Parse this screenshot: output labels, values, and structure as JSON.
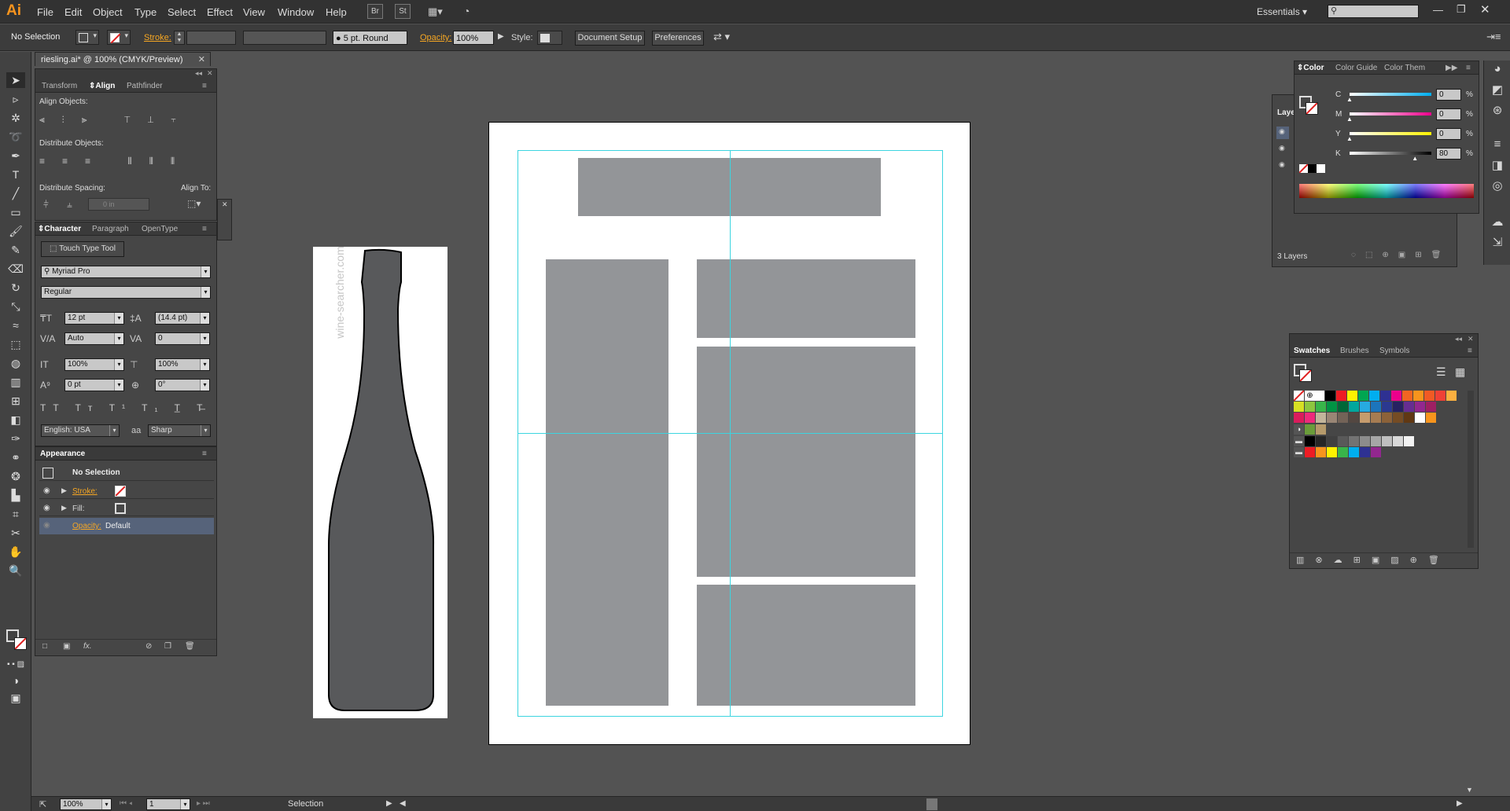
{
  "app": {
    "logo": "Ai",
    "workspace": "Essentials"
  },
  "menu": [
    "File",
    "Edit",
    "Object",
    "Type",
    "Select",
    "Effect",
    "View",
    "Window",
    "Help"
  ],
  "menu_buttons": {
    "br": "Br",
    "st": "St"
  },
  "control": {
    "selection": "No Selection",
    "stroke_label": "Stroke:",
    "brush": "5 pt. Round",
    "opacity_label": "Opacity:",
    "opacity": "100%",
    "style_label": "Style:",
    "doc_setup": "Document Setup",
    "preferences": "Preferences"
  },
  "document_tab": "riesling.ai* @ 100% (CMYK/Preview)",
  "align_panel": {
    "tabs": [
      "Transform",
      "Align",
      "Pathfinder"
    ],
    "align_objects": "Align Objects:",
    "distribute_objects": "Distribute Objects:",
    "distribute_spacing": "Distribute Spacing:",
    "align_to": "Align To:",
    "spacing_value": "0 in"
  },
  "character_panel": {
    "tabs": [
      "Character",
      "Paragraph",
      "OpenType"
    ],
    "touch_type": "Touch Type Tool",
    "font": "Myriad Pro",
    "style": "Regular",
    "size": "12 pt",
    "leading": "(14.4 pt)",
    "kerning": "Auto",
    "tracking": "0",
    "vscale": "100%",
    "hscale": "100%",
    "baseline": "0 pt",
    "rotation": "0°",
    "language": "English: USA",
    "aa": "Sharp",
    "aa_glyph": "aa"
  },
  "appearance_panel": {
    "title": "Appearance",
    "header": "No Selection",
    "stroke": "Stroke:",
    "fill": "Fill:",
    "opacity": "Opacity:",
    "opacity_value": "Default"
  },
  "layers_panel": {
    "tab": "Laye",
    "count": "3 Layers"
  },
  "color_panel": {
    "tabs": [
      "Color",
      "Color Guide",
      "Color Them"
    ],
    "channels": [
      {
        "name": "C",
        "value": "0",
        "unit": "%",
        "level": 0.0
      },
      {
        "name": "M",
        "value": "0",
        "unit": "%",
        "level": 0.0
      },
      {
        "name": "Y",
        "value": "0",
        "unit": "%",
        "level": 0.0
      },
      {
        "name": "K",
        "value": "80",
        "unit": "%",
        "level": 0.8
      }
    ]
  },
  "swatches_panel": {
    "tabs": [
      "Swatches",
      "Brushes",
      "Symbols"
    ]
  },
  "bottle_image": {
    "watermark": "wine-searcher.com"
  },
  "status": {
    "zoom": "100%",
    "artboard": "1",
    "tool": "Selection"
  },
  "swatch_colors": {
    "row1": [
      "#ffffff",
      "#000000",
      "#ed1c24",
      "#fff200",
      "#00a651",
      "#00aeef",
      "#2e3192",
      "#ec008c",
      "#f26522",
      "#f7941d",
      "#f15a24",
      "#ef4136",
      "#fbb040"
    ],
    "row2": [
      "#d7df23",
      "#8dc63f",
      "#39b54a",
      "#009444",
      "#006838",
      "#00a79d",
      "#27aae1",
      "#1c75bc",
      "#2b3990",
      "#262262",
      "#662d91",
      "#92278f",
      "#9e1f63"
    ],
    "row3": [
      "#da1c5c",
      "#ee2a7b",
      "#c2b59b",
      "#998675",
      "#736357",
      "#534741",
      "#c69c6d",
      "#a67c52",
      "#8c6239",
      "#754c24",
      "#603813",
      "#ffffff",
      "#f7941d"
    ],
    "grays": [
      "#000000",
      "#262626",
      "#404040",
      "#595959",
      "#737373",
      "#8c8c8c",
      "#a6a6a6",
      "#bfbfbf",
      "#d9d9d9",
      "#f2f2f2"
    ],
    "bright": [
      "#ed1c24",
      "#f7941d",
      "#fff200",
      "#39b54a",
      "#00aeef",
      "#2e3192",
      "#92278f"
    ]
  }
}
